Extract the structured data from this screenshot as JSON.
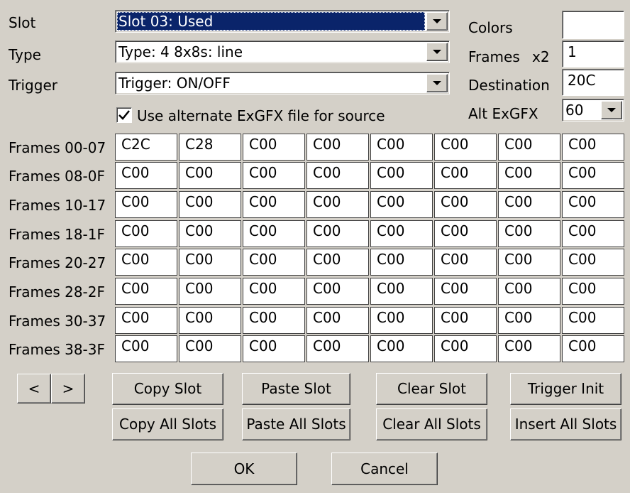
{
  "form": {
    "slot": {
      "label": "Slot",
      "value": "Slot 03: Used"
    },
    "type": {
      "label": "Type",
      "value": "Type: 4 8x8s: line"
    },
    "trigger": {
      "label": "Trigger",
      "value": "Trigger: ON/OFF"
    },
    "alt_exgfx_checkbox": {
      "label": "Use alternate ExGFX file for source",
      "checked": true
    },
    "colors": {
      "label": "Colors",
      "value": ""
    },
    "frames": {
      "label": "Frames",
      "multiplier": "x2",
      "value": "1"
    },
    "destination": {
      "label": "Destination",
      "value": "20C"
    },
    "alt_exgfx": {
      "label": "Alt ExGFX",
      "value": "60"
    }
  },
  "grid": {
    "rows": [
      {
        "label": "Frames 00-07",
        "cells": [
          "C2C",
          "C28",
          "C00",
          "C00",
          "C00",
          "C00",
          "C00",
          "C00"
        ]
      },
      {
        "label": "Frames 08-0F",
        "cells": [
          "C00",
          "C00",
          "C00",
          "C00",
          "C00",
          "C00",
          "C00",
          "C00"
        ]
      },
      {
        "label": "Frames 10-17",
        "cells": [
          "C00",
          "C00",
          "C00",
          "C00",
          "C00",
          "C00",
          "C00",
          "C00"
        ]
      },
      {
        "label": "Frames 18-1F",
        "cells": [
          "C00",
          "C00",
          "C00",
          "C00",
          "C00",
          "C00",
          "C00",
          "C00"
        ]
      },
      {
        "label": "Frames 20-27",
        "cells": [
          "C00",
          "C00",
          "C00",
          "C00",
          "C00",
          "C00",
          "C00",
          "C00"
        ]
      },
      {
        "label": "Frames 28-2F",
        "cells": [
          "C00",
          "C00",
          "C00",
          "C00",
          "C00",
          "C00",
          "C00",
          "C00"
        ]
      },
      {
        "label": "Frames 30-37",
        "cells": [
          "C00",
          "C00",
          "C00",
          "C00",
          "C00",
          "C00",
          "C00",
          "C00"
        ]
      },
      {
        "label": "Frames 38-3F",
        "cells": [
          "C00",
          "C00",
          "C00",
          "C00",
          "C00",
          "C00",
          "C00",
          "C00"
        ]
      }
    ]
  },
  "nav": {
    "prev": "<",
    "next": ">"
  },
  "actions": {
    "copy_slot": "Copy Slot",
    "paste_slot": "Paste Slot",
    "clear_slot": "Clear Slot",
    "trigger_init": "Trigger Init",
    "copy_all_slots": "Copy All Slots",
    "paste_all_slots": "Paste All Slots",
    "clear_all_slots": "Clear All Slots",
    "insert_all_slots": "Insert All Slots"
  },
  "dialog": {
    "ok": "OK",
    "cancel": "Cancel"
  }
}
